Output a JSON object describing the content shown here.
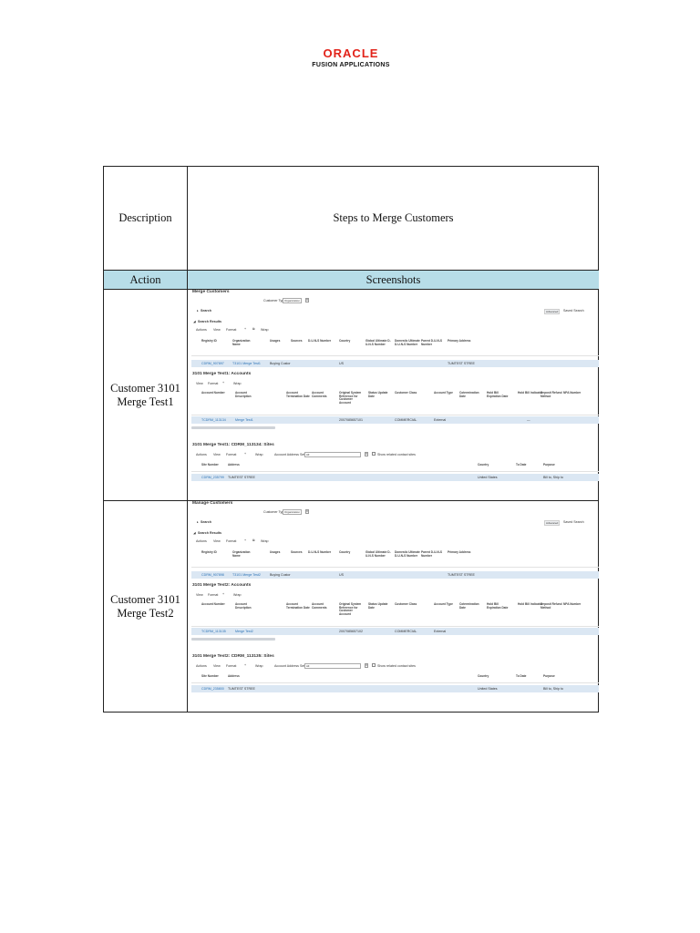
{
  "logo": {
    "line1": "ORACLE",
    "line2": "FUSION APPLICATIONS",
    "brand_color": "#e2231a"
  },
  "table": {
    "description_label": "Description",
    "description_value": "Steps to Merge Customers",
    "action_header": "Action",
    "screenshots_header": "Screenshots",
    "header_color": "#b7dde8",
    "rows": [
      {
        "action": [
          "Customer 3101",
          "Merge Test1"
        ]
      },
      {
        "action": [
          "Customer 3101",
          "Merge Test2"
        ]
      }
    ]
  },
  "shots": [
    {
      "title": "Merge Customers",
      "customer_type_label": "Customer Type",
      "customer_type_value": "Organization",
      "search_label": "Search",
      "advanced": "Advanced",
      "saved_search": "Saved Search",
      "search_results": "Search Results",
      "toolbar": [
        "Actions",
        "View",
        "Format"
      ],
      "wrap": "Wrap",
      "cust_cols": [
        "Registry ID",
        "Organization Name",
        "Usages",
        "Sources",
        "D-U-N-S Number",
        "Country",
        "Global Ultimate D-U-N-S Number",
        "Domestic Ultimate D-U-N-S Number",
        "Parent D-U-N-S Number",
        "Primary Address"
      ],
      "cust_row": {
        "registry_id": "CDRM_907897",
        "org_name": "T3101 Merge Test1",
        "usage": "Buying Custor",
        "country": "US",
        "address": "TUMTEST STREE"
      },
      "accounts_title": "3101 Merge Test1: Accounts",
      "acct_toolbar": [
        "View",
        "Format"
      ],
      "acct_cols": [
        "Account Number",
        "Account Description",
        "Account Termination Date",
        "Account Comments",
        "Original System Reference for Customer Account",
        "Status Update Date",
        "Customer Class",
        "Account Type",
        "Cotermination Date",
        "Hold Bill Expiration Date",
        "Hold Bill Indicator",
        "Deposit Refund Method",
        "NPA Number"
      ],
      "acct_row": {
        "number": "TCDRM_113134",
        "desc": "Merge Test1",
        "orig_ref": "2007085657101",
        "class": "COMMERCIAL",
        "type": "External",
        "extra": "—"
      },
      "sites_title": "3101 Merge Test1: CDRM_113134: Sites",
      "sites_toolbar": [
        "Actions",
        "View",
        "Format"
      ],
      "address_set_label": "Account Address Set",
      "address_set_value": "All",
      "show_related": "Show related contact sites",
      "site_cols": [
        "Site Number",
        "Address",
        "Country",
        "To Date",
        "Purpose"
      ],
      "site_row": {
        "number": "CDRM_235799",
        "address": "TUMTEST STREE",
        "country": "United States",
        "purpose": "Bill to, Ship to"
      }
    },
    {
      "title": "Manage Customers",
      "customer_type_label": "Customer Type",
      "customer_type_value": "Organization",
      "search_label": "Search",
      "advanced": "Advanced",
      "saved_search": "Saved Search",
      "search_results": "Search Results",
      "toolbar": [
        "Actions",
        "View",
        "Format"
      ],
      "wrap": "Wrap",
      "cust_cols": [
        "Registry ID",
        "Organization Name",
        "Usages",
        "Sources",
        "D-U-N-S Number",
        "Country",
        "Global Ultimate D-U-N-S Number",
        "Domestic Ultimate D-U-N-S Number",
        "Parent D-U-N-S Number",
        "Primary Address"
      ],
      "cust_row": {
        "registry_id": "CDRM_907898",
        "org_name": "T3101 Merge Test2",
        "usage": "Buying Custor",
        "country": "US",
        "address": "TUMTEST STREE"
      },
      "accounts_title": "3101 Merge Test2: Accounts",
      "acct_toolbar": [
        "View",
        "Format"
      ],
      "acct_cols": [
        "Account Number",
        "Account Description",
        "Account Termination Date",
        "Account Comments",
        "Original System Reference for Customer Account",
        "Status Update Date",
        "Customer Class",
        "Account Type",
        "Cotermination Date",
        "Hold Bill Expiration Date",
        "Hold Bill Indicator",
        "Deposit Refund Method",
        "NPA Number"
      ],
      "acct_row": {
        "number": "TCDRM_113135",
        "desc": "Merge Test2",
        "orig_ref": "2007085657102",
        "class": "COMMERCIAL",
        "type": "External",
        "extra": ""
      },
      "sites_title": "3101 Merge Test2: CDRM_113135: Sites",
      "sites_toolbar": [
        "Actions",
        "View",
        "Format"
      ],
      "address_set_label": "Account Address Set",
      "address_set_value": "All",
      "show_related": "Show related contact sites",
      "site_cols": [
        "Site Number",
        "Address",
        "Country",
        "To Date",
        "Purpose"
      ],
      "site_row": {
        "number": "CDRM_235800",
        "address": "TUMTEST STREE",
        "country": "United States",
        "purpose": "Bill to, Ship to"
      }
    }
  ]
}
